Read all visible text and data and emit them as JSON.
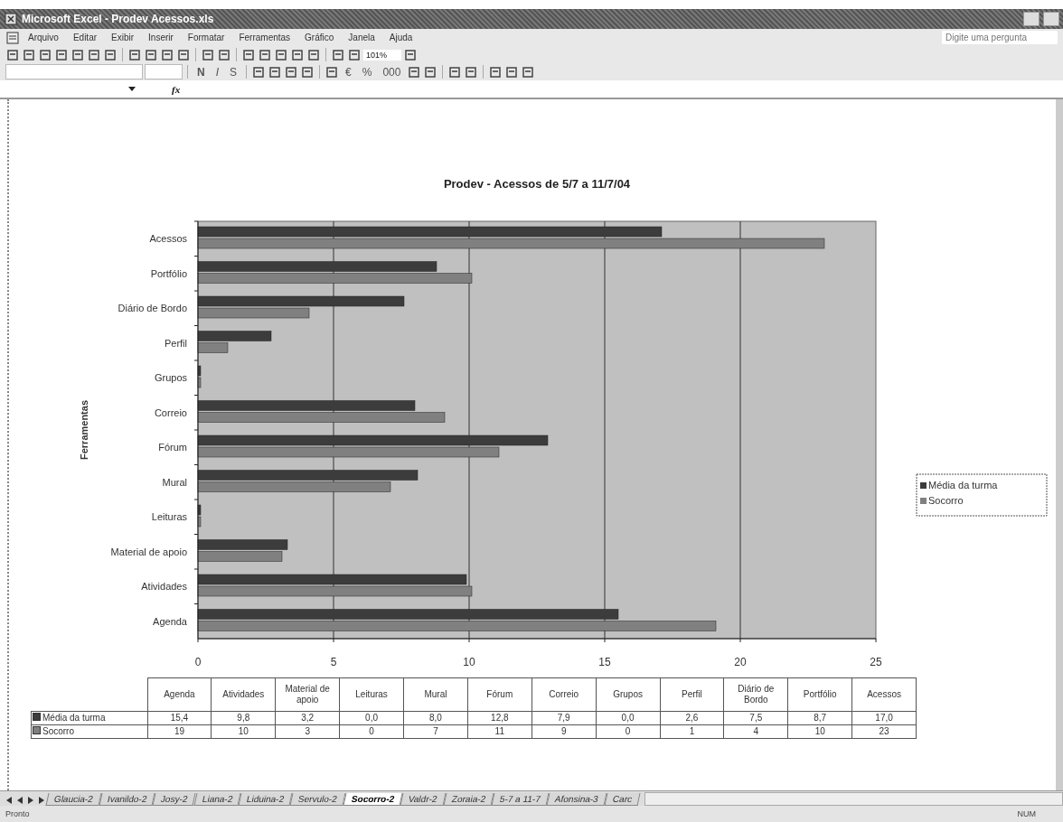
{
  "window": {
    "title": "Microsoft Excel - Prodev Acessos.xls"
  },
  "menu": [
    "Arquivo",
    "Editar",
    "Exibir",
    "Inserir",
    "Formatar",
    "Ferramentas",
    "Gráfico",
    "Janela",
    "Ajuda"
  ],
  "help_box": {
    "placeholder": "Digite uma pergunta"
  },
  "standard_toolbar": {
    "zoom": "101%"
  },
  "format_toolbar": {
    "style_buttons": [
      "N",
      "I",
      "S"
    ],
    "number_buttons": [
      "€",
      "%",
      "000"
    ]
  },
  "formula_bar": {
    "function_label": "fx"
  },
  "chart": {
    "chart_data": {
      "type": "bar",
      "orientation": "horizontal",
      "title": "Prodev - Acessos de 5/7 a 11/7/04",
      "ylabel": "Ferramentas",
      "categories": [
        "Acessos",
        "Portfólio",
        "Diário de Bordo",
        "Perfil",
        "Grupos",
        "Correio",
        "Fórum",
        "Mural",
        "Leituras",
        "Material de apoio",
        "Atividades",
        "Agenda"
      ],
      "series": [
        {
          "name": "Média da turma",
          "color": "#3c3c3c",
          "values": [
            17.0,
            8.7,
            7.5,
            2.6,
            0.0,
            7.9,
            12.8,
            8.0,
            0.0,
            3.2,
            9.8,
            15.4
          ]
        },
        {
          "name": "Socorro",
          "color": "#808080",
          "values": [
            23,
            10,
            4,
            1,
            0,
            9,
            11,
            7,
            0,
            3,
            10,
            19
          ]
        }
      ],
      "xlim": [
        0,
        25
      ],
      "xticks": [
        0,
        5,
        10,
        15,
        20,
        25
      ],
      "grid": true,
      "legend": true
    },
    "data_table": {
      "columns": [
        "Agenda",
        "Atividades",
        "Material de apoio",
        "Leituras",
        "Mural",
        "Fórum",
        "Correio",
        "Grupos",
        "Perfil",
        "Diário de Bordo",
        "Portfólio",
        "Acessos"
      ],
      "rows": [
        {
          "label": "Média da turma",
          "cells": [
            "15,4",
            "9,8",
            "3,2",
            "0,0",
            "8,0",
            "12,8",
            "7,9",
            "0,0",
            "2,6",
            "7,5",
            "8,7",
            "17,0"
          ]
        },
        {
          "label": "Socorro",
          "cells": [
            "19",
            "10",
            "3",
            "0",
            "7",
            "11",
            "9",
            "0",
            "1",
            "4",
            "10",
            "23"
          ]
        }
      ]
    }
  },
  "sheet_tabs": [
    {
      "label": "Glaucia-2",
      "selected": false
    },
    {
      "label": "Ivanildo-2",
      "selected": false
    },
    {
      "label": "Josy-2",
      "selected": false
    },
    {
      "label": "Liana-2",
      "selected": false
    },
    {
      "label": "Liduina-2",
      "selected": false
    },
    {
      "label": "Servulo-2",
      "selected": false
    },
    {
      "label": "Socorro-2",
      "selected": true
    },
    {
      "label": "Valdr-2",
      "selected": false
    },
    {
      "label": "Zoraia-2",
      "selected": false
    },
    {
      "label": "5-7 a 11-7",
      "selected": false
    },
    {
      "label": "Afonsina-3",
      "selected": false
    },
    {
      "label": "Carc",
      "selected": false
    }
  ],
  "status_bar": {
    "left": "Pronto",
    "right": "NUM"
  }
}
